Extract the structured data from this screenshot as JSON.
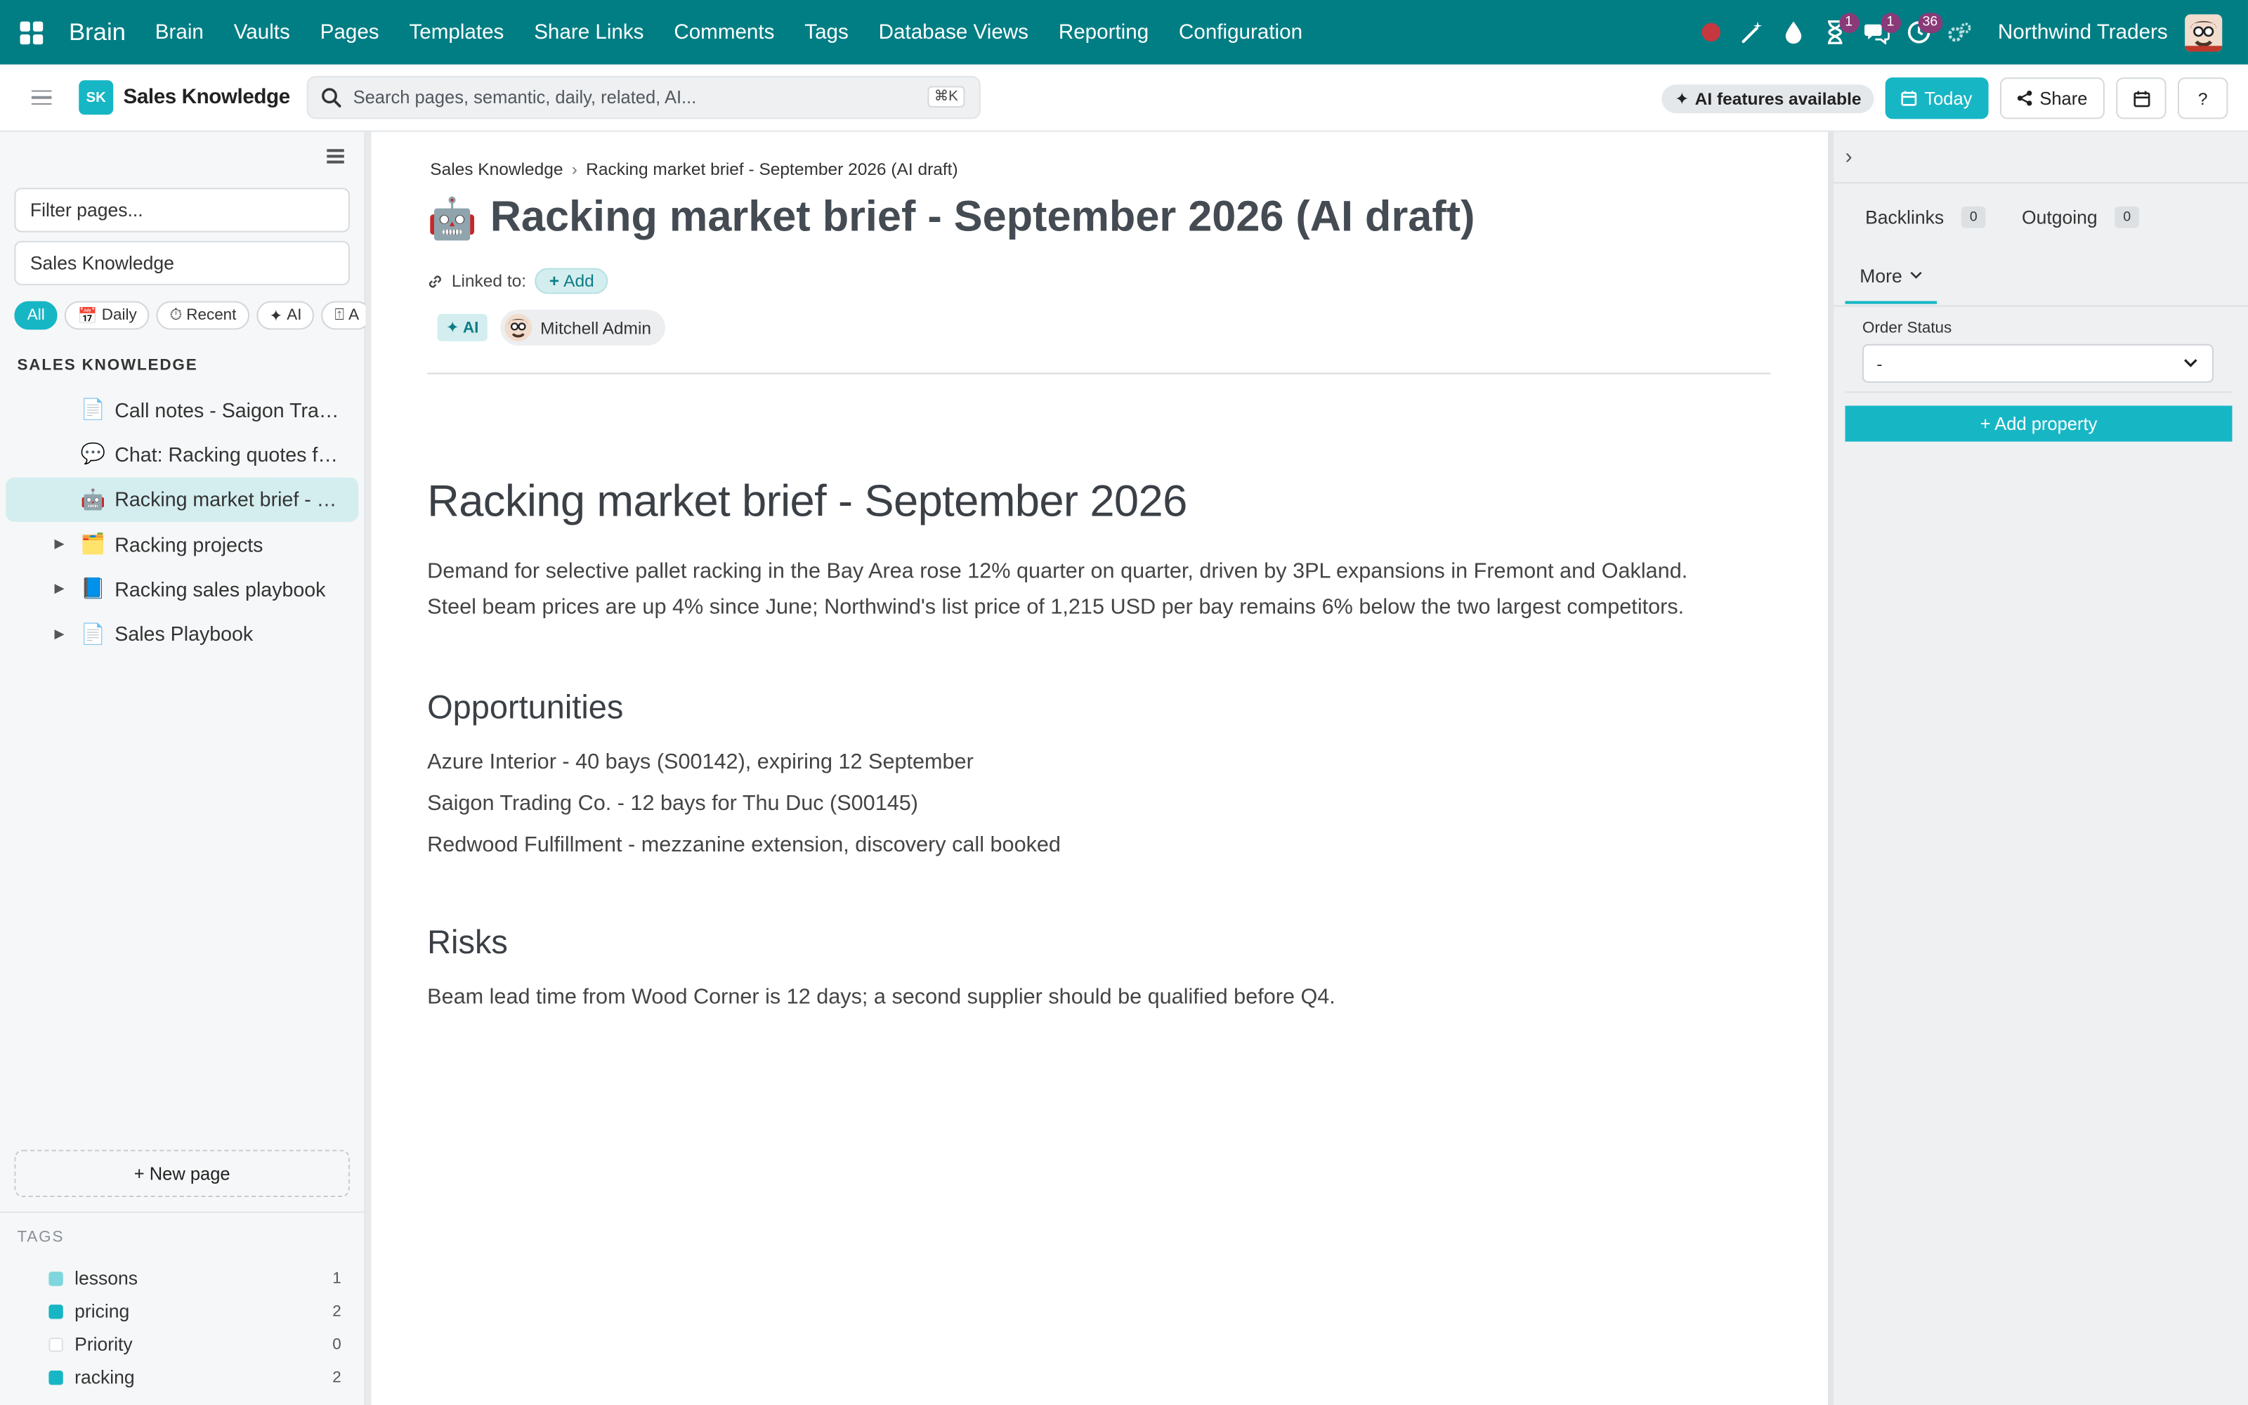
{
  "topnav": {
    "brand": "Brain",
    "menu": [
      "Brain",
      "Vaults",
      "Pages",
      "Templates",
      "Share Links",
      "Comments",
      "Tags",
      "Database Views",
      "Reporting",
      "Configuration"
    ],
    "badges": {
      "activity": "1",
      "messages": "1",
      "timers": "36"
    },
    "company": "Northwind Traders",
    "accent": "#017e84"
  },
  "toolbar": {
    "vault_initials": "SK",
    "vault_name": "Sales Knowledge",
    "search_placeholder": "Search pages, semantic, daily, related, AI...",
    "search_shortcut": "⌘K",
    "ai_features": "AI features available",
    "today": "Today",
    "share": "Share",
    "help": "?"
  },
  "sidebar": {
    "filter_placeholder": "Filter pages...",
    "vault_select": "Sales Knowledge",
    "chips": [
      {
        "icon": "",
        "label": "All"
      },
      {
        "icon": "📅",
        "label": "Daily"
      },
      {
        "icon": "⏱",
        "label": "Recent"
      },
      {
        "icon": "✦",
        "label": "AI"
      },
      {
        "icon": "⍐",
        "label": "A"
      }
    ],
    "section_title": "SALES KNOWLEDGE",
    "tree": [
      {
        "icon": "📄",
        "label": "Call notes - Saigon Trading Co.",
        "caret": false,
        "active": false
      },
      {
        "icon": "💬",
        "label": "Chat: Racking quotes for Azure Interior",
        "caret": false,
        "active": false
      },
      {
        "icon": "🤖",
        "label": "Racking market brief - September 2026 (AI draft)",
        "caret": false,
        "active": true
      },
      {
        "icon": "🗂️",
        "label": "Racking projects",
        "caret": true,
        "active": false
      },
      {
        "icon": "📘",
        "label": "Racking sales playbook",
        "caret": true,
        "active": false
      },
      {
        "icon": "📄",
        "label": "Sales Playbook",
        "caret": true,
        "active": false
      }
    ],
    "new_page": "+ New page",
    "tags_title": "TAGS",
    "tags": [
      {
        "label": "lessons",
        "count": "1",
        "color": "#7fd6dc"
      },
      {
        "label": "pricing",
        "count": "2",
        "color": "#17b6c4"
      },
      {
        "label": "Priority",
        "count": "0",
        "color": "#ffffff"
      },
      {
        "label": "racking",
        "count": "2",
        "color": "#17b6c4"
      }
    ]
  },
  "main": {
    "breadcrumb": [
      "Sales Knowledge",
      "Racking market brief - September 2026 (AI draft)"
    ],
    "title_icon": "🤖",
    "title": "Racking market brief - September 2026 (AI draft)",
    "linked_label": "Linked to:",
    "add_label": "Add",
    "ai_tag": "✦ AI",
    "author": "Mitchell Admin",
    "doc": {
      "heading": "Racking market brief - September 2026",
      "para1": "Demand for selective pallet racking in the Bay Area rose 12% quarter on quarter, driven by 3PL expansions in Fremont and Oakland.",
      "para2": "Steel beam prices are up 4% since June; Northwind's list price of 1,215 USD per bay remains 6% below the two largest competitors.",
      "opps_heading": "Opportunities",
      "opps": [
        "Azure Interior - 40 bays (S00142), expiring 12 September",
        "Saigon Trading Co. - 12 bays for Thu Duc (S00145)",
        "Redwood Fulfillment - mezzanine extension, discovery call booked"
      ],
      "risks_heading": "Risks",
      "risks": "Beam lead time from Wood Corner is 12 days; a second supplier should be qualified before Q4."
    }
  },
  "rpanel": {
    "backlinks": "Backlinks",
    "backlinks_count": "0",
    "outgoing": "Outgoing",
    "outgoing_count": "0",
    "more": "More",
    "order_status_label": "Order Status",
    "order_status_value": "-",
    "add_property": "+ Add property"
  }
}
